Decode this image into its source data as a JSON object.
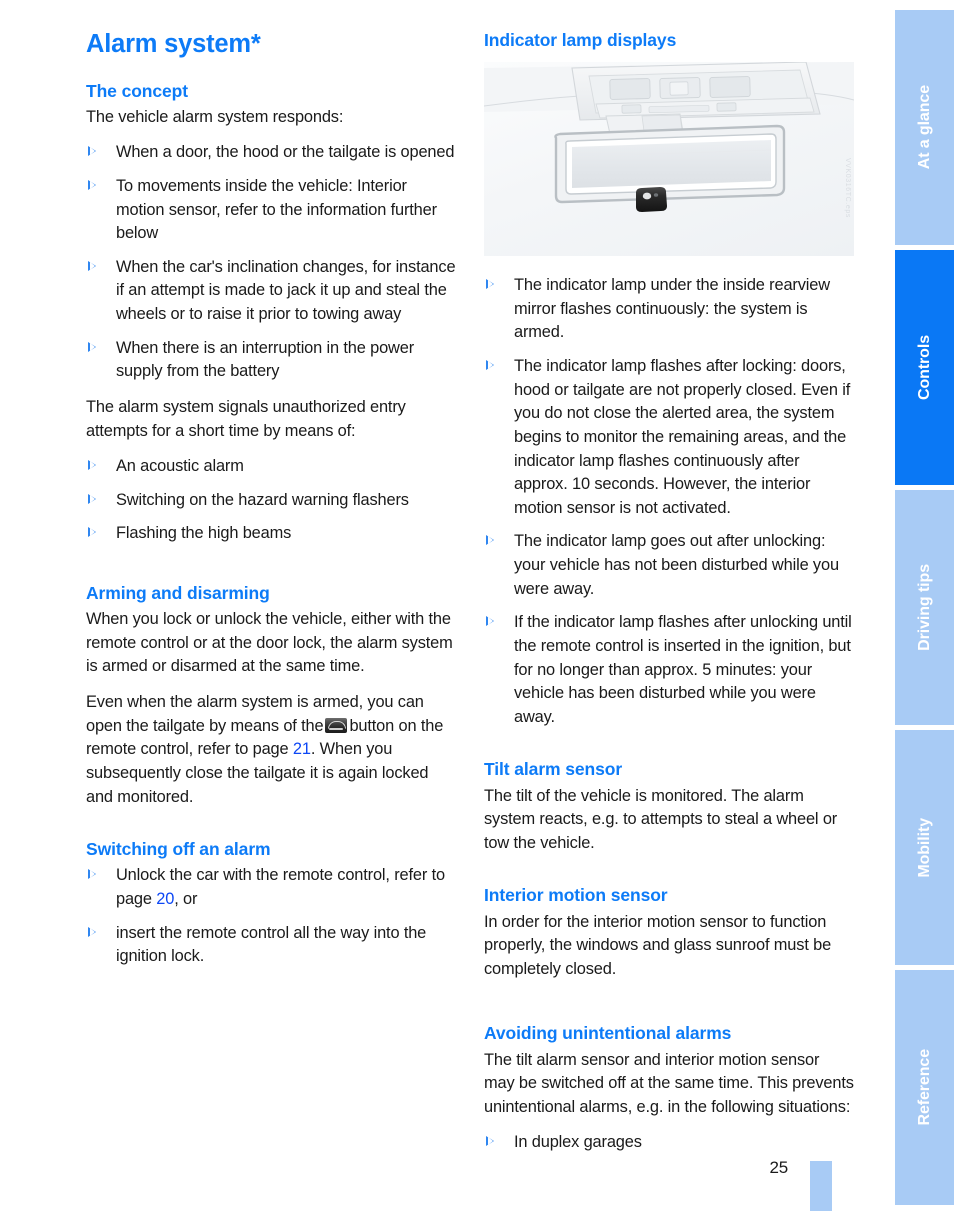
{
  "document": {
    "page_number": "25",
    "title": "Alarm system*"
  },
  "left_column": {
    "heading_concept": "The concept",
    "concept_intro": "The vehicle alarm system responds:",
    "concept_bullets": [
      "When a door, the hood or the tailgate is opened",
      "To movements inside the vehicle: Interior motion sensor, refer to the information further below",
      "When the car's inclination changes, for instance if an attempt is made to jack it up and steal the wheels or to raise it prior to towing away",
      "When there is an interruption in the power supply from the battery"
    ],
    "signals_intro": "The alarm system signals unauthorized entry attempts for a short time by means of:",
    "signals_bullets": [
      "An acoustic alarm",
      "Switching on the hazard warning flashers",
      "Flashing the high beams"
    ],
    "heading_arming": "Arming and disarming",
    "arming_para_1": "When you lock or unlock the vehicle, either with the remote control or at the door lock, the alarm system is armed or disarmed at the same time.",
    "arming_para_2_a": "Even when the alarm system is armed, you can open the tailgate by means of the",
    "arming_para_2_b": "button on the remote control, refer to page",
    "arming_para_2_pageref": "21",
    "arming_para_2_c": ". When you subsequently close the tailgate it is again locked and monitored.",
    "heading_switching_off": "Switching off an alarm",
    "switching_off_bullet_1_a": "Unlock the car with the remote control, refer to page",
    "switching_off_bullet_1_pageref": "20",
    "switching_off_bullet_1_b": ", or",
    "switching_off_bullet_2": "insert the remote control all the way into the ignition lock."
  },
  "right_column": {
    "heading_indicator": "Indicator lamp displays",
    "figure": {
      "alt": "Inside rearview mirror with indicator lamp underneath",
      "watermark": "VVK0316TC.eps"
    },
    "indicator_bullets": [
      "The indicator lamp under the inside rearview mirror flashes continuously: the system is armed.",
      "The indicator lamp flashes after locking: doors, hood or tailgate are not properly closed. Even if you do not close the alerted area, the system begins to monitor the remaining areas, and the indicator lamp flashes continuously after approx. 10 seconds. However, the interior motion sensor is not activated.",
      "The indicator lamp goes out after unlocking: your vehicle has not been disturbed while you were away.",
      "If the indicator lamp flashes after unlocking until the remote control is inserted in the ignition, but for no longer than approx. 5 minutes: your vehicle has been disturbed while you were away."
    ],
    "heading_tilt": "Tilt alarm sensor",
    "tilt_para": "The tilt of the vehicle is monitored. The alarm system reacts, e.g. to attempts to steal a wheel or tow the vehicle.",
    "heading_interior": "Interior motion sensor",
    "interior_para": "In order for the interior motion sensor to function properly, the windows and glass sunroof must be completely closed.",
    "heading_avoiding": "Avoiding unintentional alarms",
    "avoiding_para": "The tilt alarm sensor and interior motion sensor may be switched off at the same time. This prevents unintentional alarms, e.g. in the following situations:",
    "avoiding_bullets": [
      "In duplex garages"
    ]
  },
  "sidebar": {
    "tabs": [
      {
        "label": "At a glance",
        "active": false
      },
      {
        "label": "Controls",
        "active": true
      },
      {
        "label": "Driving tips",
        "active": false
      },
      {
        "label": "Mobility",
        "active": false
      },
      {
        "label": "Reference",
        "active": false
      }
    ]
  },
  "colors": {
    "heading_blue": "#0d7bf7",
    "link_blue": "#0d47f5",
    "tab_active": "#0a78f5",
    "tab_inactive": "#a8cbf5",
    "bullet_marker": "#2f86f0"
  }
}
